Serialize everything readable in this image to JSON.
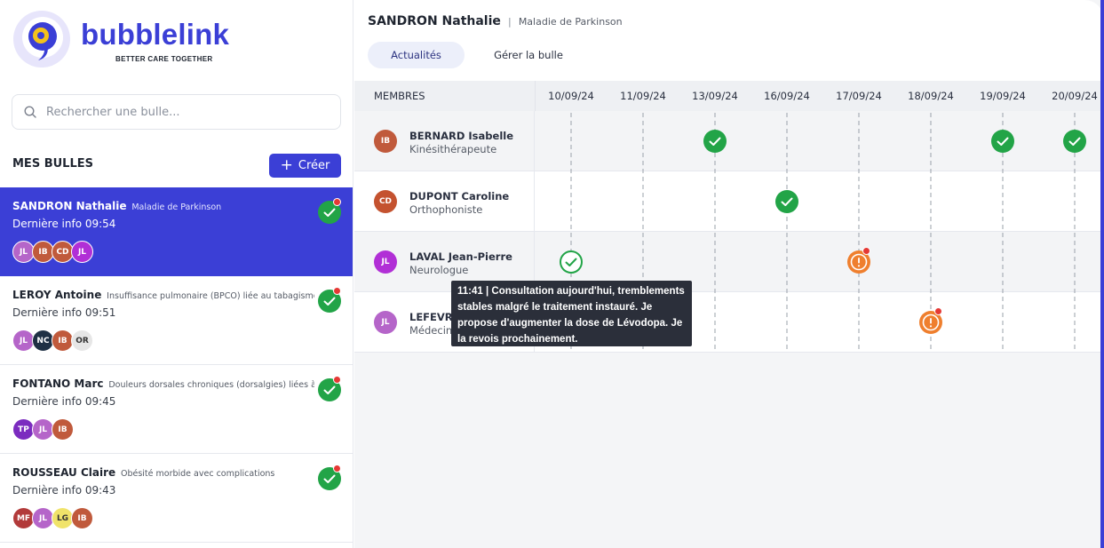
{
  "brand": {
    "name": "bubblelink",
    "tagline": "BETTER CARE TOGETHER",
    "accent": "#3b3fd6"
  },
  "search": {
    "placeholder": "Rechercher une bulle..."
  },
  "sidebar": {
    "section_title": "MES BULLES",
    "create_label": "Créer",
    "bubbles": [
      {
        "name": "SANDRON Nathalie",
        "condition": "Maladie de Parkinson",
        "last_info": "Dernière info 09:54",
        "active": true,
        "members": [
          {
            "initials": "JL",
            "color": "#b565c9"
          },
          {
            "initials": "IB",
            "color": "#c05a3c"
          },
          {
            "initials": "CD",
            "color": "#c05a3c"
          },
          {
            "initials": "JL",
            "color": "#b12fd6"
          }
        ]
      },
      {
        "name": "LEROY Antoine",
        "condition": "Insuffisance pulmonaire (BPCO) liée au tabagisme actif",
        "last_info": "Dernière info 09:51",
        "members": [
          {
            "initials": "JL",
            "color": "#b565c9"
          },
          {
            "initials": "NC",
            "color": "#1f3044"
          },
          {
            "initials": "IB",
            "color": "#c05a3c"
          },
          {
            "initials": "OR",
            "color": "#e6e6e6",
            "text": "#333"
          }
        ]
      },
      {
        "name": "FONTANO Marc",
        "condition": "Douleurs dorsales chroniques (dorsalgies) liées à une...",
        "last_info": "Dernière info 09:45",
        "members": [
          {
            "initials": "TP",
            "color": "#7b2bbf"
          },
          {
            "initials": "JL",
            "color": "#b565c9"
          },
          {
            "initials": "IB",
            "color": "#c05a3c"
          }
        ]
      },
      {
        "name": "ROUSSEAU Claire",
        "condition": "Obésité morbide avec complications",
        "last_info": "Dernière info 09:43",
        "members": [
          {
            "initials": "MF",
            "color": "#b23a3a"
          },
          {
            "initials": "JL",
            "color": "#b565c9"
          },
          {
            "initials": "LG",
            "color": "#f0e36a",
            "text": "#333"
          },
          {
            "initials": "IB",
            "color": "#c05a3c"
          }
        ]
      }
    ]
  },
  "header": {
    "patient_name": "SANDRON Nathalie",
    "separator": "|",
    "condition": "Maladie de Parkinson",
    "tabs": [
      {
        "label": "Actualités",
        "active": true
      },
      {
        "label": "Gérer la bulle",
        "active": false
      }
    ]
  },
  "timeline": {
    "members_header": "MEMBRES",
    "dates": [
      "10/09/24",
      "11/09/24",
      "13/09/24",
      "16/09/24",
      "17/09/24",
      "18/09/24",
      "19/09/24",
      "20/09/24"
    ],
    "members": [
      {
        "initials": "IB",
        "color": "#c05a3c",
        "name": "BERNARD Isabelle",
        "role": "Kinésithérapeute",
        "events": [
          {
            "date": "13/09/24",
            "type": "done"
          },
          {
            "date": "19/09/24",
            "type": "done"
          },
          {
            "date": "20/09/24",
            "type": "done"
          }
        ]
      },
      {
        "initials": "CD",
        "color": "#c4522f",
        "name": "DUPONT Caroline",
        "role": "Orthophoniste",
        "events": [
          {
            "date": "16/09/24",
            "type": "done"
          }
        ]
      },
      {
        "initials": "JL",
        "color": "#b12fd6",
        "name": "LAVAL Jean-Pierre",
        "role": "Neurologue",
        "events": [
          {
            "date": "10/09/24",
            "type": "done-outline"
          },
          {
            "date": "17/09/24",
            "type": "alert",
            "unread": true
          }
        ]
      },
      {
        "initials": "JL",
        "color": "#b565c9",
        "name": "LEFEVRE",
        "role": "Médecin",
        "events": [
          {
            "date": "18/09/24",
            "type": "alert",
            "unread": true
          }
        ]
      }
    ],
    "tooltip": "11:41 | Consultation aujourd'hui, tremblements stables malgré le traitement instauré. Je propose d'augmenter la dose de Lévodopa. Je la revois prochainement."
  },
  "colors": {
    "success": "#22a447",
    "warning": "#ef7f2e",
    "unread": "#e53935"
  }
}
